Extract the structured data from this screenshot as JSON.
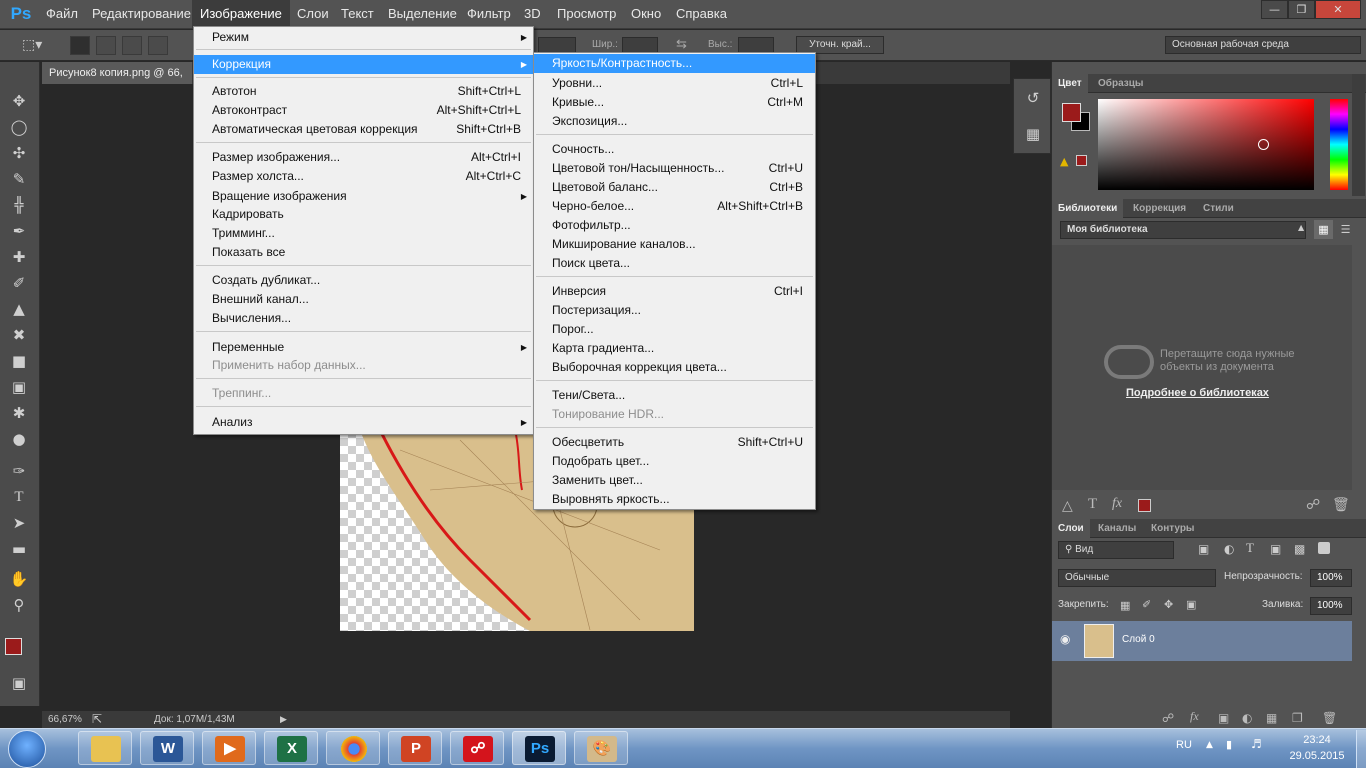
{
  "app": {
    "logo": "Ps",
    "accent": "#31a8ff"
  },
  "menubar": {
    "items": [
      "Файл",
      "Редактирование",
      "Изображение",
      "Слои",
      "Текст",
      "Выделение",
      "Фильтр",
      "3D",
      "Просмотр",
      "Окно",
      "Справка"
    ],
    "active": "Изображение",
    "window_controls": [
      "minimize-icon",
      "restore-icon",
      "close-icon"
    ]
  },
  "options": {
    "width_label": "Шир.:",
    "height_label": "Выс.:",
    "refine_button": "Уточн. край...",
    "workspace": "Основная рабочая среда"
  },
  "document": {
    "tab_title": "Рисунок8 копия.png @ 66,",
    "zoom": "66,67%",
    "doc_info": "Док: 1,07M/1,43M"
  },
  "image_menu": {
    "items": [
      {
        "label": "Режим",
        "shortcut": "",
        "submenu": true,
        "disabled": false
      },
      {
        "label": "Коррекция",
        "shortcut": "",
        "submenu": true,
        "disabled": false,
        "highlighted": true
      },
      {
        "label": "Автотон",
        "shortcut": "Shift+Ctrl+L"
      },
      {
        "label": "Автоконтраст",
        "shortcut": "Alt+Shift+Ctrl+L"
      },
      {
        "label": "Автоматическая цветовая коррекция",
        "shortcut": "Shift+Ctrl+B"
      },
      {
        "label": "Размер изображения...",
        "shortcut": "Alt+Ctrl+I"
      },
      {
        "label": "Размер холста...",
        "shortcut": "Alt+Ctrl+C"
      },
      {
        "label": "Вращение изображения",
        "shortcut": "",
        "submenu": true
      },
      {
        "label": "Кадрировать",
        "shortcut": ""
      },
      {
        "label": "Тримминг...",
        "shortcut": ""
      },
      {
        "label": "Показать все",
        "shortcut": ""
      },
      {
        "label": "Создать дубликат...",
        "shortcut": ""
      },
      {
        "label": "Внешний канал...",
        "shortcut": ""
      },
      {
        "label": "Вычисления...",
        "shortcut": ""
      },
      {
        "label": "Переменные",
        "shortcut": "",
        "submenu": true
      },
      {
        "label": "Применить набор данных...",
        "shortcut": "",
        "disabled": true
      },
      {
        "label": "Треппинг...",
        "shortcut": "",
        "disabled": true
      },
      {
        "label": "Анализ",
        "shortcut": "",
        "submenu": true
      }
    ]
  },
  "correction_menu": {
    "items": [
      {
        "label": "Яркость/Контрастность...",
        "shortcut": "",
        "highlighted": true
      },
      {
        "label": "Уровни...",
        "shortcut": "Ctrl+L"
      },
      {
        "label": "Кривые...",
        "shortcut": "Ctrl+M"
      },
      {
        "label": "Экспозиция...",
        "shortcut": ""
      },
      {
        "label": "Сочность...",
        "shortcut": ""
      },
      {
        "label": "Цветовой тон/Насыщенность...",
        "shortcut": "Ctrl+U"
      },
      {
        "label": "Цветовой баланс...",
        "shortcut": "Ctrl+B"
      },
      {
        "label": "Черно-белое...",
        "shortcut": "Alt+Shift+Ctrl+B"
      },
      {
        "label": "Фотофильтр...",
        "shortcut": ""
      },
      {
        "label": "Микширование каналов...",
        "shortcut": ""
      },
      {
        "label": "Поиск цвета...",
        "shortcut": ""
      },
      {
        "label": "Инверсия",
        "shortcut": "Ctrl+I"
      },
      {
        "label": "Постеризация...",
        "shortcut": ""
      },
      {
        "label": "Порог...",
        "shortcut": ""
      },
      {
        "label": "Карта градиента...",
        "shortcut": ""
      },
      {
        "label": "Выборочная коррекция цвета...",
        "shortcut": ""
      },
      {
        "label": "Тени/Света...",
        "shortcut": ""
      },
      {
        "label": "Тонирование HDR...",
        "shortcut": "",
        "disabled": true
      },
      {
        "label": "Обесцветить",
        "shortcut": "Shift+Ctrl+U"
      },
      {
        "label": "Подобрать цвет...",
        "shortcut": ""
      },
      {
        "label": "Заменить цвет...",
        "shortcut": ""
      },
      {
        "label": "Выровнять яркость...",
        "shortcut": ""
      }
    ]
  },
  "color_panel": {
    "tabs": [
      "Цвет",
      "Образцы"
    ],
    "fg_color": "#9b1b1b",
    "bg_color": "#000000"
  },
  "libraries_panel": {
    "tabs": [
      "Библиотеки",
      "Коррекция",
      "Стили"
    ],
    "library": "Моя библиотека",
    "drop_hint": "Перетащите сюда нужные объекты из документа",
    "learn_more": "Подробнее о библиотеках"
  },
  "layers_panel": {
    "tabs": [
      "Слои",
      "Каналы",
      "Контуры"
    ],
    "filter": "Вид",
    "blend_mode": "Обычные",
    "opacity_label": "Непрозрачность:",
    "opacity": "100%",
    "lock_label": "Закрепить:",
    "fill_label": "Заливка:",
    "fill": "100%",
    "layers": [
      {
        "name": "Слой 0"
      }
    ]
  },
  "taskbar": {
    "lang": "RU",
    "time": "23:24",
    "date": "29.05.2015"
  }
}
